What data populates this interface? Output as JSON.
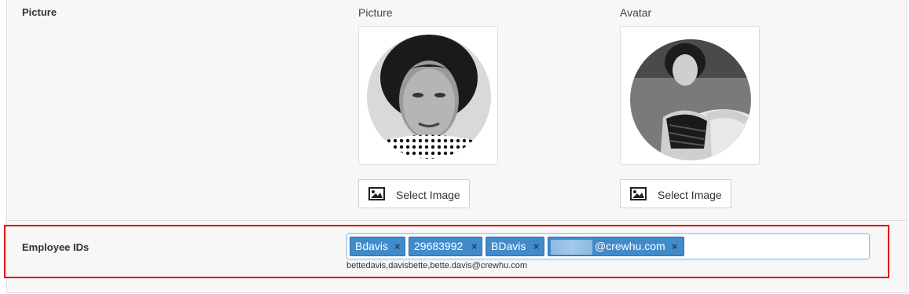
{
  "picture_row": {
    "label": "Picture",
    "columns": [
      {
        "caption": "Picture",
        "image_alt": "portrait-photo",
        "button_label": "Select Image",
        "button_icon": "image-icon"
      },
      {
        "caption": "Avatar",
        "image_alt": "avatar-photo",
        "button_label": "Select Image",
        "button_icon": "image-icon"
      }
    ]
  },
  "employee_ids_row": {
    "label": "Employee IDs",
    "tags": [
      {
        "text": "Bdavis",
        "remove": "×"
      },
      {
        "text": "29683992",
        "remove": "×"
      },
      {
        "text": "BDavis",
        "remove": "×"
      },
      {
        "text": "@crewhu.com",
        "remove": "×"
      }
    ],
    "hint": "bettedavis,davisbette,bette.davis@crewhu.com"
  },
  "colors": {
    "tag_bg": "#428bca",
    "highlight": "#e00000",
    "panel_bg": "#f7f7f7"
  }
}
